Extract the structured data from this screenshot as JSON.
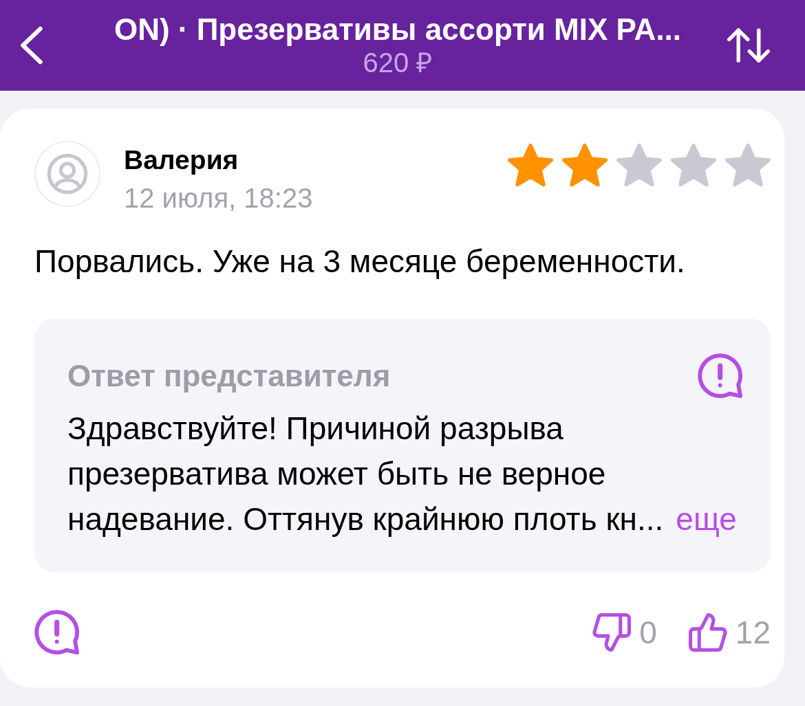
{
  "header": {
    "title": "ON) · Презервативы ассорти MIX PA...",
    "price": "620 ₽"
  },
  "review": {
    "author": "Валерия",
    "date": "12 июля, 18:23",
    "stars": 2,
    "text": "Порвались. Уже на 3 месяце беременности.",
    "reply": {
      "title": "Ответ представителя",
      "text": "Здравствуйте! Причиной разрыва презерватива может быть не верное надевание. Оттянув крайнюю плоть кн...",
      "more": "еще"
    },
    "dislikes": "0",
    "likes": "12"
  }
}
